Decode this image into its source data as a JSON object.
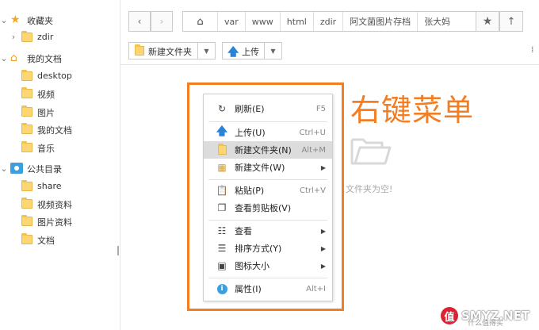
{
  "sidebar": {
    "favorites": {
      "label": "收藏夹"
    },
    "favorites_items": [
      {
        "label": "zdir"
      }
    ],
    "my_docs": {
      "label": "我的文档"
    },
    "my_docs_items": [
      {
        "label": "desktop"
      },
      {
        "label": "视频"
      },
      {
        "label": "图片"
      },
      {
        "label": "我的文档"
      },
      {
        "label": "音乐"
      }
    ],
    "public": {
      "label": "公共目录"
    },
    "public_items": [
      {
        "label": "share"
      },
      {
        "label": "视频资料"
      },
      {
        "label": "图片资料"
      },
      {
        "label": "文档"
      }
    ]
  },
  "nav": {
    "back_icon": "chevron-left-icon",
    "forward_icon": "chevron-right-icon",
    "breadcrumbs": [
      "var",
      "www",
      "html",
      "zdir",
      "阿文菌图片存档",
      "张大妈"
    ]
  },
  "toolbar": {
    "new_folder": "新建文件夹",
    "upload": "上传"
  },
  "main": {
    "empty_text": "文件夹为空!",
    "annotation": "右键菜单"
  },
  "context_menu": {
    "items": [
      {
        "label": "刷新(E)",
        "shortcut": "F5",
        "icon": "refresh-icon"
      },
      {
        "label": "上传(U)",
        "shortcut": "Ctrl+U",
        "icon": "upload-icon"
      },
      {
        "label": "新建文件夹(N)",
        "shortcut": "Alt+M",
        "icon": "folder-icon"
      },
      {
        "label": "新建文件(W)",
        "shortcut": "",
        "icon": "new-file-icon"
      },
      {
        "label": "粘贴(P)",
        "shortcut": "Ctrl+V",
        "icon": "paste-icon"
      },
      {
        "label": "查看剪贴板(V)",
        "shortcut": "",
        "icon": "clipboard-icon"
      },
      {
        "label": "查看",
        "shortcut": "",
        "icon": "view-icon"
      },
      {
        "label": "排序方式(Y)",
        "shortcut": "",
        "icon": "sort-icon"
      },
      {
        "label": "图标大小",
        "shortcut": "",
        "icon": "icon-size-icon"
      },
      {
        "label": "属性(I)",
        "shortcut": "Alt+I",
        "icon": "info-icon"
      }
    ]
  },
  "watermark": {
    "text": "SMYZ.NET",
    "badge": "值",
    "sub": "什么值得买"
  },
  "colors": {
    "accent": "#f47d22",
    "folder": "#fbd672",
    "upload": "#2b83d9"
  }
}
